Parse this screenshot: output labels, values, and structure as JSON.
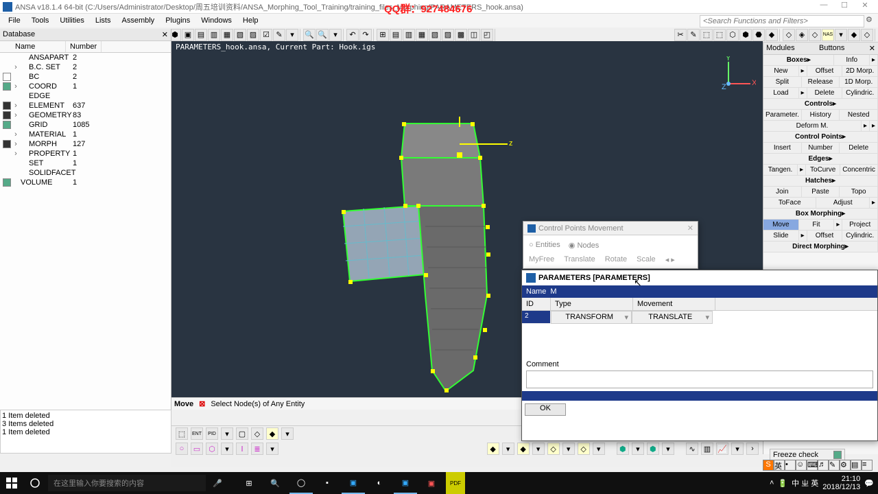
{
  "title": "ANSA v18.1.4 64-bit  (C:/Users/Administrator/Desktop/周五培训资料/ANSA_Morphing_Tool_Training/training_files_Morphing/PARAMETERS_hook.ansa)",
  "overlay_text": "QQ群：927484676",
  "menu": [
    "File",
    "Tools",
    "Utilities",
    "Lists",
    "Assembly",
    "Plugins",
    "Windows",
    "Help"
  ],
  "search_placeholder": "<Search Functions and Filters>",
  "database": {
    "header": "Database",
    "cols": [
      "Name",
      "Number"
    ],
    "rows": [
      {
        "chk": "none",
        "exp": "",
        "name": "ANSAPART",
        "num": "2",
        "indent": true
      },
      {
        "chk": "none",
        "exp": "›",
        "name": "B.C. SET",
        "num": "2",
        "indent": true
      },
      {
        "chk": "off",
        "exp": "",
        "name": "BC",
        "num": "2",
        "indent": true
      },
      {
        "chk": "on",
        "exp": "›",
        "name": "COORD",
        "num": "1",
        "indent": true
      },
      {
        "chk": "none",
        "exp": "",
        "name": "EDGE",
        "num": "",
        "indent": true
      },
      {
        "chk": "dark",
        "exp": "›",
        "name": "ELEMENT",
        "num": "637",
        "indent": true
      },
      {
        "chk": "dark",
        "exp": "›",
        "name": "GEOMETRY",
        "num": "83",
        "indent": true
      },
      {
        "chk": "on",
        "exp": "",
        "name": "GRID",
        "num": "1085",
        "indent": true
      },
      {
        "chk": "none",
        "exp": "›",
        "name": "MATERIAL",
        "num": "1",
        "indent": true
      },
      {
        "chk": "dark",
        "exp": "›",
        "name": "MORPH",
        "num": "127",
        "indent": true
      },
      {
        "chk": "none",
        "exp": "›",
        "name": "PROPERTY",
        "num": "1",
        "indent": true
      },
      {
        "chk": "none",
        "exp": "",
        "name": "SET",
        "num": "1",
        "indent": true
      },
      {
        "chk": "none",
        "exp": "",
        "name": "SOLIDFACET",
        "num": "",
        "indent": true
      },
      {
        "chk": "on",
        "exp": "",
        "name": "VOLUME",
        "num": "1",
        "indent": false
      }
    ]
  },
  "viewport": {
    "title": "PARAMETERS_hook.ansa,  Current Part: Hook.igs",
    "status_mode": "Move",
    "status_msg": "Select Node(s) of Any Entity"
  },
  "log": [
    "1 Item deleted",
    "3 Items deleted",
    "1 Item deleted"
  ],
  "right": {
    "header_left": "Modules",
    "header_right": "Buttons",
    "sections": [
      {
        "title": "Boxes",
        "info": "Info",
        "rows": [
          [
            "New",
            "",
            "Offset",
            "2D Morp."
          ],
          [
            "Split",
            "Release",
            "1D Morp."
          ],
          [
            "Load",
            "",
            "Delete",
            "Cylindric."
          ]
        ]
      },
      {
        "title": "Controls",
        "rows": [
          [
            "Parameter.",
            "History",
            "Nested"
          ],
          [
            "Deform M.",
            "",
            ""
          ]
        ]
      },
      {
        "title": "Control Points",
        "rows": [
          [
            "Insert",
            "Number",
            "Delete"
          ]
        ]
      },
      {
        "title": "Edges",
        "rows": [
          [
            "Tangen.",
            "",
            "ToCurve",
            "Concentric"
          ]
        ]
      },
      {
        "title": "Hatches",
        "rows": [
          [
            "Join",
            "Paste",
            "Topo"
          ],
          [
            "ToFace",
            "Adjust",
            ""
          ]
        ]
      },
      {
        "title": "Box Morphing",
        "rows": [
          [
            "Move",
            "Fit",
            "",
            "Project"
          ],
          [
            "Slide",
            "",
            "Offset",
            "Cylindric."
          ]
        ]
      },
      {
        "title": "Direct Morphing",
        "rows": []
      }
    ]
  },
  "cp_dialog": {
    "title": "Control Points Movement",
    "radios": [
      "Entities",
      "Nodes"
    ],
    "tabs": [
      "MyFree",
      "Translate",
      "Rotate",
      "Scale"
    ]
  },
  "param_dialog": {
    "title": "PARAMETERS [PARAMETERS]",
    "name_label": "Name",
    "name_value": "M",
    "cols": [
      "ID",
      "Type",
      "Movement"
    ],
    "row": {
      "id": "2",
      "type": "TRANSFORM",
      "movement": "TRANSLATE"
    },
    "comment_label": "Comment",
    "ok": "OK"
  },
  "freeze": "Freeze check",
  "taskbar": {
    "search_placeholder": "在这里输入你要搜索的内容",
    "time": "21:10",
    "date": "2018/12/13"
  }
}
